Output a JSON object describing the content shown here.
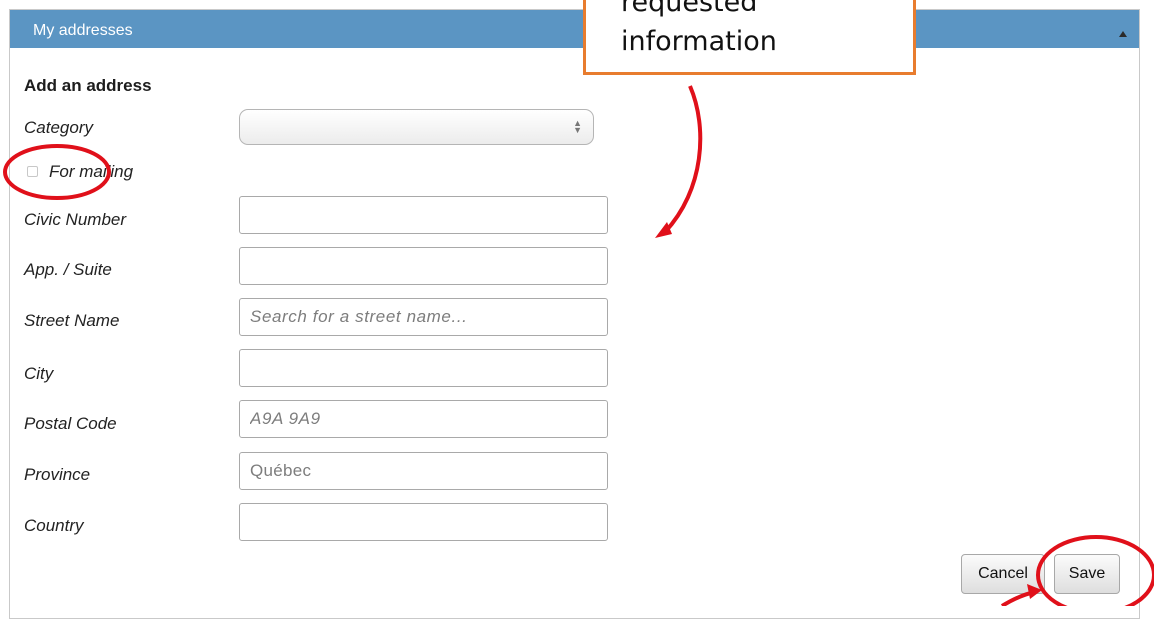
{
  "panel": {
    "title": "My addresses"
  },
  "form": {
    "section_title": "Add an address",
    "category_label": "Category",
    "category_value": "",
    "mailing_label": "For mailing",
    "mailing_checked": false,
    "fields": [
      {
        "label": "Civic Number",
        "value": "",
        "placeholder": ""
      },
      {
        "label": "App. / Suite",
        "value": "",
        "placeholder": ""
      },
      {
        "label": "Street Name",
        "value": "",
        "placeholder": "Search for a street name..."
      },
      {
        "label": "City",
        "value": "",
        "placeholder": ""
      },
      {
        "label": "Postal Code",
        "value": "",
        "placeholder": "A9A 9A9"
      },
      {
        "label": "Province",
        "value": "",
        "placeholder": "Québec"
      },
      {
        "label": "Country",
        "value": "",
        "placeholder": ""
      }
    ]
  },
  "buttons": {
    "cancel": "Cancel",
    "save": "Save"
  },
  "annotation": {
    "callout_line1": "requested",
    "callout_line2": "information",
    "callout_border_color": "#e87c2e",
    "marker_color": "#e0101a"
  },
  "colors": {
    "header": "#5b95c3",
    "header_text": "#ffffff"
  }
}
